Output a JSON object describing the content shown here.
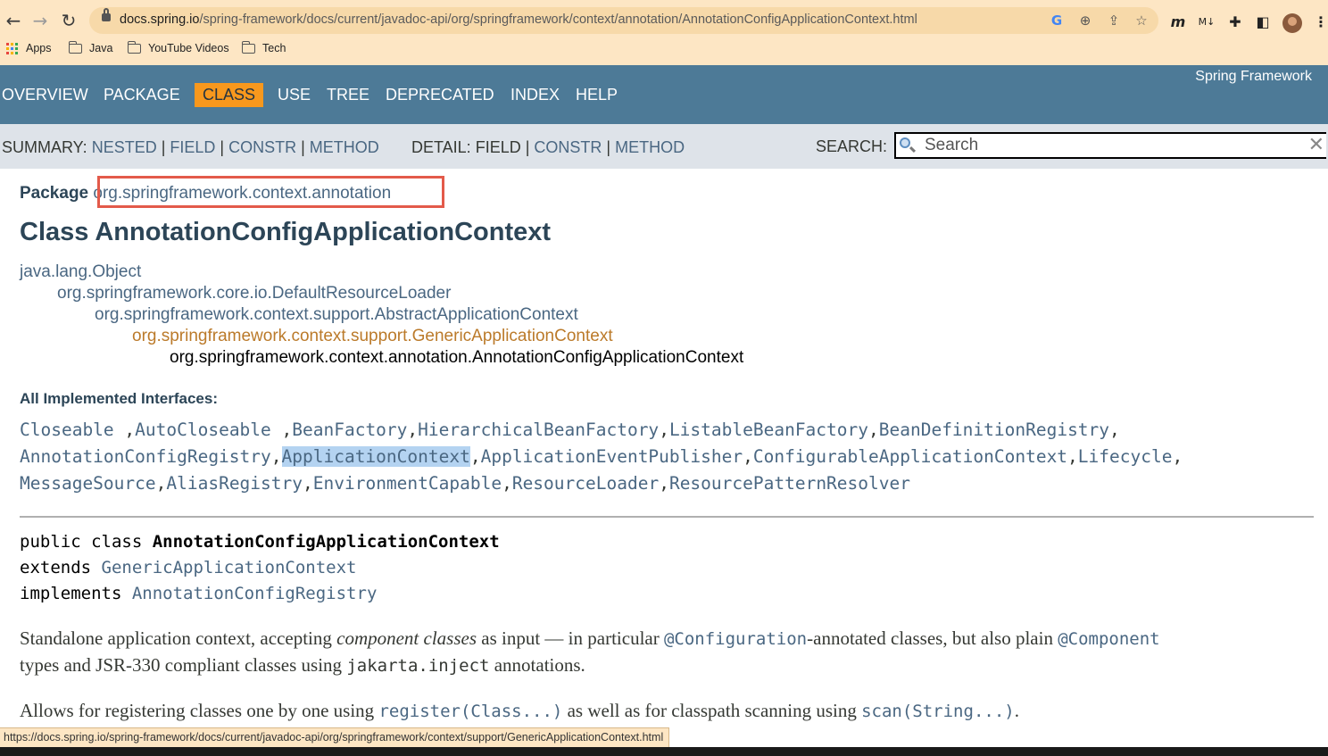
{
  "browser": {
    "url_host": "docs.spring.io",
    "url_path": "/spring-framework/docs/current/javadoc-api/org/springframework/context/annotation/AnnotationConfigApplicationContext.html",
    "bookmarks": [
      "Apps",
      "Java",
      "YouTube Videos",
      "Tech"
    ],
    "status_url": "https://docs.spring.io/spring-framework/docs/current/javadoc-api/org/springframework/context/support/GenericApplicationContext.html"
  },
  "topnav": {
    "items": [
      "OVERVIEW",
      "PACKAGE",
      "CLASS",
      "USE",
      "TREE",
      "DEPRECATED",
      "INDEX",
      "HELP"
    ],
    "active": "CLASS",
    "brand": "Spring Framework"
  },
  "subnav": {
    "summary_label": "SUMMARY:",
    "summary_links": [
      "NESTED",
      "FIELD",
      "CONSTR",
      "METHOD"
    ],
    "detail_label": "DETAIL:",
    "detail_field": "FIELD",
    "detail_links": [
      "CONSTR",
      "METHOD"
    ],
    "search_label": "SEARCH:",
    "search_placeholder": "Search"
  },
  "page": {
    "package_label": "Package",
    "package_name": "org.springframework.context.annotation",
    "class_title": "Class AnnotationConfigApplicationContext",
    "inheritance": [
      "java.lang.Object",
      "org.springframework.core.io.DefaultResourceLoader",
      "org.springframework.context.support.AbstractApplicationContext",
      "org.springframework.context.support.GenericApplicationContext",
      "org.springframework.context.annotation.AnnotationConfigApplicationContext"
    ],
    "interfaces_heading": "All Implemented Interfaces:",
    "interfaces": [
      "Closeable",
      "AutoCloseable",
      "BeanFactory",
      "HierarchicalBeanFactory",
      "ListableBeanFactory",
      "BeanDefinitionRegistry",
      "AnnotationConfigRegistry",
      "ApplicationContext",
      "ApplicationEventPublisher",
      "ConfigurableApplicationContext",
      "Lifecycle",
      "MessageSource",
      "AliasRegistry",
      "EnvironmentCapable",
      "ResourceLoader",
      "ResourcePatternResolver"
    ],
    "declaration": {
      "line1_prefix": "public class ",
      "class_name": "AnnotationConfigApplicationContext",
      "extends_kw": "extends ",
      "extends_cls": "GenericApplicationContext",
      "implements_kw": "implements ",
      "implements_cls": "AnnotationConfigRegistry"
    },
    "desc1": {
      "a": "Standalone application context, accepting ",
      "em": "component classes",
      "b": " as input — in particular ",
      "code1": "@Configuration",
      "c": "-annotated classes, but also plain ",
      "code2": "@Component",
      "line2_a": "types and JSR-330 compliant classes using ",
      "code3": "jakarta.inject",
      "line2_b": " annotations."
    },
    "desc2": {
      "a": "Allows for registering classes one by one using ",
      "code1": "register(Class...)",
      "b": " as well as for classpath scanning using ",
      "code2": "scan(String...)",
      "c": "."
    }
  }
}
